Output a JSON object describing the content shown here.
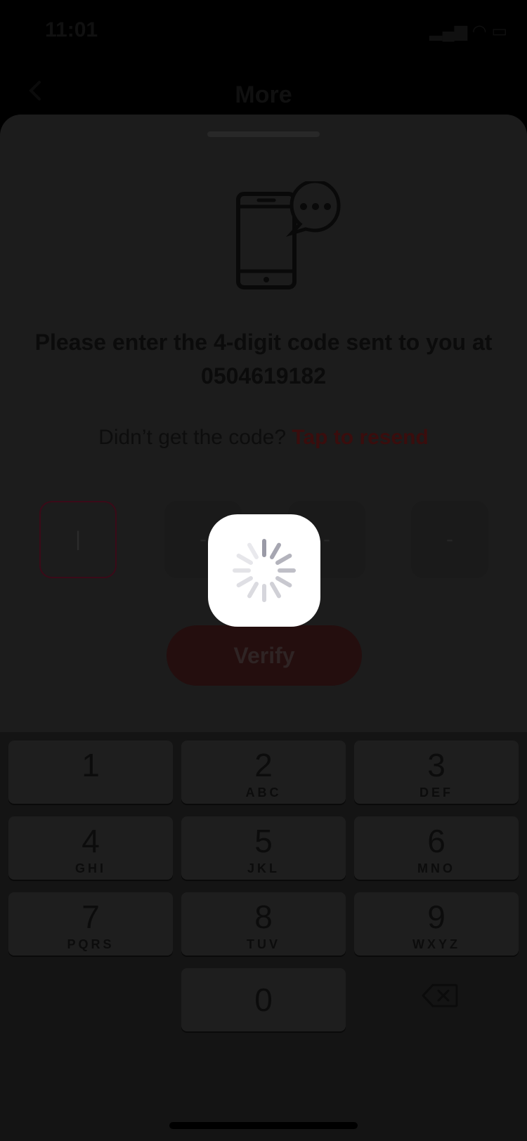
{
  "status_bar": {
    "time": "11:01",
    "indicators": "signal wifi battery"
  },
  "navbar": {
    "title": "More",
    "back_icon": "chevron-left-icon"
  },
  "verification": {
    "illustration_icon": "phone-message-icon",
    "prompt": "Please enter the 4-digit code sent to you at 0504619182",
    "resend_question": "Didn’t get the code?",
    "resend_link": "Tap  to resend",
    "otp_boxes": [
      "|",
      "-",
      "-",
      "-"
    ],
    "verify_label": "Verify"
  },
  "keyboard": {
    "keys": [
      {
        "digit": "1",
        "letters": ""
      },
      {
        "digit": "2",
        "letters": "ABC"
      },
      {
        "digit": "3",
        "letters": "DEF"
      },
      {
        "digit": "4",
        "letters": "GHI"
      },
      {
        "digit": "5",
        "letters": "JKL"
      },
      {
        "digit": "6",
        "letters": "MNO"
      },
      {
        "digit": "7",
        "letters": "PQRS"
      },
      {
        "digit": "8",
        "letters": "TUV"
      },
      {
        "digit": "9",
        "letters": "WXYZ"
      },
      {
        "digit": "0",
        "letters": ""
      }
    ],
    "delete_icon": "backspace-icon"
  },
  "loading": {
    "icon": "activity-spinner-icon"
  },
  "colors": {
    "accent": "#c8102e",
    "overlay": "#000000"
  }
}
